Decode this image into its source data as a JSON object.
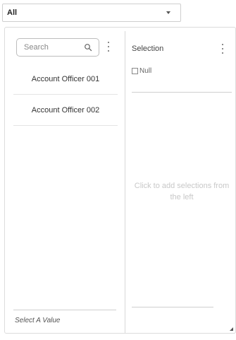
{
  "dropdown": {
    "selected": "All"
  },
  "left_pane": {
    "search_placeholder": "Search",
    "items": [
      {
        "label": "Account Officer 001"
      },
      {
        "label": "Account Officer 002"
      }
    ],
    "footer_hint": "Select A Value"
  },
  "right_pane": {
    "title": "Selection",
    "null_label": "Null",
    "empty_hint": "Click to add selections from the left"
  },
  "icons": [
    "chevron-down-icon",
    "search-icon",
    "more-vertical-icon",
    "resize-grip-icon"
  ]
}
